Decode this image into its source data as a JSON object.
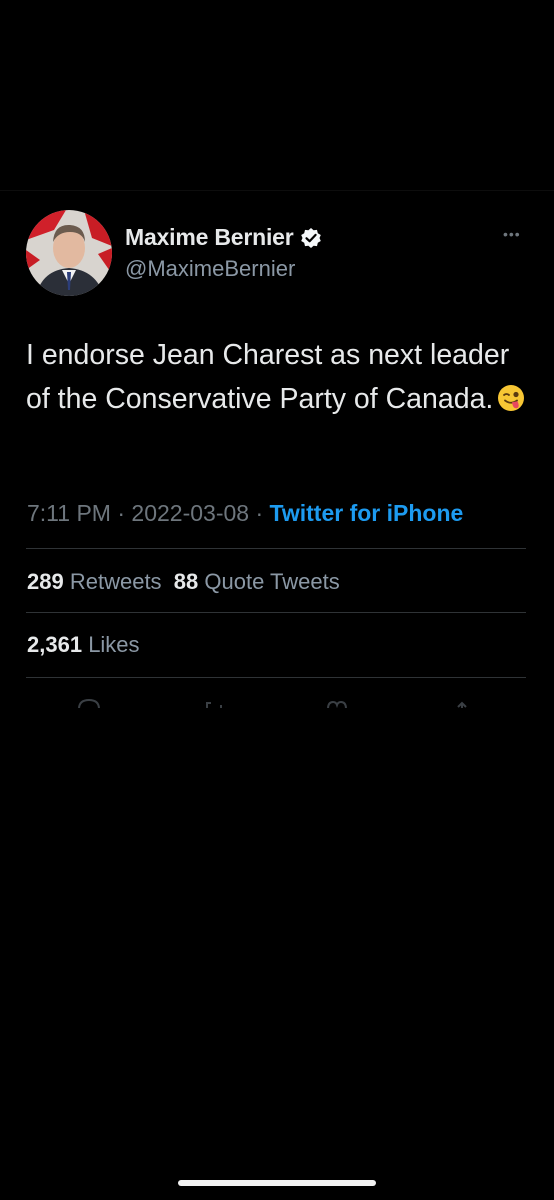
{
  "tweet": {
    "author": {
      "display_name": "Maxime Bernier",
      "handle": "@MaximeBernier",
      "verified": true,
      "avatar_icon": "profile-photo"
    },
    "text": "I endorse Jean Charest as next leader of the Conservative Party of Canada.",
    "emoji": "winking-face-with-tongue",
    "time": "7:11 PM",
    "separator": " · ",
    "date": "2022-03-08",
    "source": "Twitter for iPhone",
    "stats": {
      "retweets_count": "289",
      "retweets_label": "Retweets",
      "quotes_count": "88",
      "quotes_label": "Quote Tweets",
      "likes_count": "2,361",
      "likes_label": "Likes"
    }
  },
  "colors": {
    "background": "#000000",
    "text_primary": "#e7e9ea",
    "text_secondary": "#8b98a5",
    "link": "#1d9bf0",
    "divider": "#2f3336"
  }
}
